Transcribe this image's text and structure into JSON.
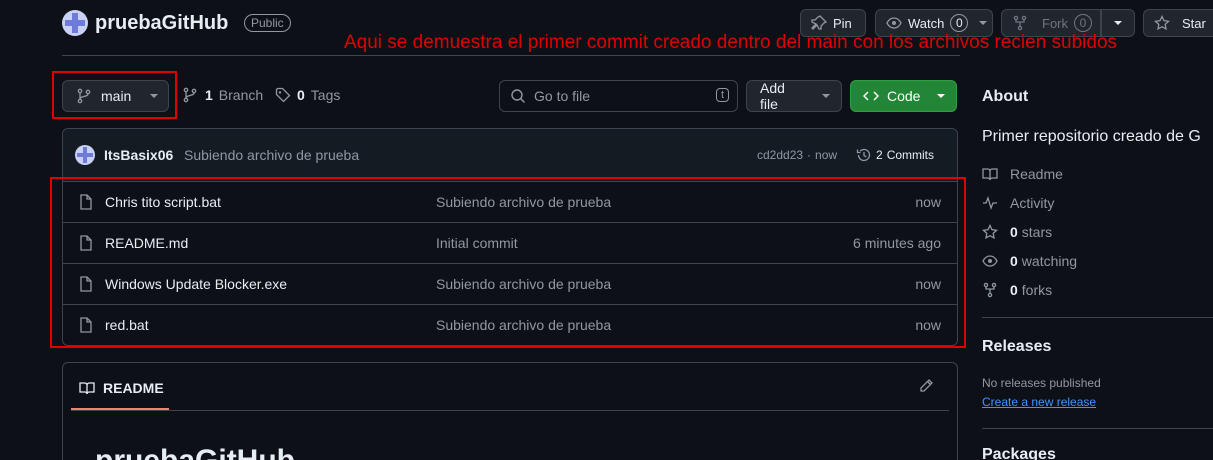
{
  "repo": {
    "name": "pruebaGitHub",
    "visibility": "Public"
  },
  "header_actions": {
    "pin": "Pin",
    "watch": "Watch",
    "watch_count": "0",
    "fork": "Fork",
    "fork_count": "0",
    "star": "Star"
  },
  "annotation": "Aqui se demuestra el primer commit creado dentro del main con los archivos recien subidos",
  "branch_bar": {
    "branch": "main",
    "branch_count": "1",
    "branch_label": "Branch",
    "tag_count": "0",
    "tag_label": "Tags",
    "goto_placeholder": "Go to file",
    "goto_shortcut": "t",
    "add_file": "Add file",
    "code": "Code"
  },
  "commit": {
    "author": "ItsBasix06",
    "message": "Subiendo archivo de prueba",
    "hash": "cd2dd23",
    "sep": "·",
    "time": "now",
    "commits_count": "2",
    "commits_label": "Commits"
  },
  "files": [
    {
      "name": "Chris tito script.bat",
      "message": "Subiendo archivo de prueba",
      "time": "now"
    },
    {
      "name": "README.md",
      "message": "Initial commit",
      "time": "6 minutes ago"
    },
    {
      "name": "Windows Update Blocker.exe",
      "message": "Subiendo archivo de prueba",
      "time": "now"
    },
    {
      "name": "red.bat",
      "message": "Subiendo archivo de prueba",
      "time": "now"
    }
  ],
  "readme": {
    "tab": "README",
    "heading": "pruebaGitHub"
  },
  "about": {
    "title": "About",
    "description": "Primer repositorio creado de G",
    "readme": "Readme",
    "activity": "Activity",
    "stars_count": "0",
    "stars_label": "stars",
    "watching_count": "0",
    "watching_label": "watching",
    "forks_count": "0",
    "forks_label": "forks"
  },
  "releases": {
    "title": "Releases",
    "none": "No releases published",
    "create": "Create a new release"
  },
  "packages": {
    "title": "Packages"
  },
  "colors": {
    "background": "#0d1117",
    "border": "#3d444d",
    "code_button": "#238636",
    "link": "#4493f8",
    "annotation_red": "#e00000"
  }
}
